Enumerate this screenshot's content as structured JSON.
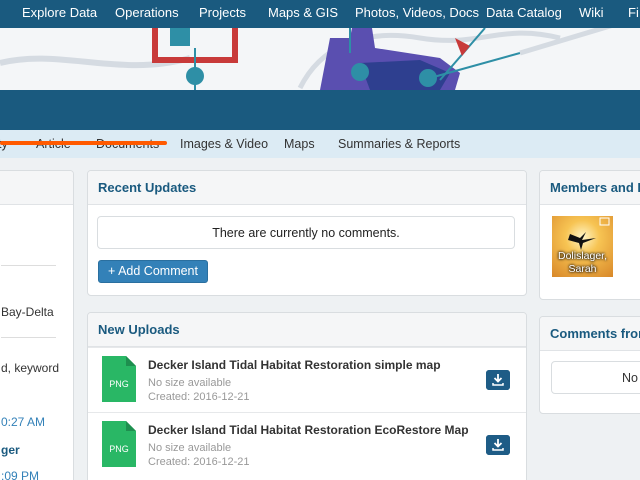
{
  "topnav": [
    "Explore Data",
    "Operations",
    "Projects",
    "Maps & GIS",
    "Photos, Videos, Docs",
    "Data Catalog",
    "Wiki",
    "Fi"
  ],
  "subnav": [
    "ty",
    "Article",
    "Documents",
    "Images & Video",
    "Maps",
    "Summaries & Reports"
  ],
  "left_panel": {
    "lines": [
      "Bay-Delta",
      "d, keyword",
      "0:27 AM",
      "ger",
      ":09 PM"
    ]
  },
  "recent_updates": {
    "title": "Recent Updates",
    "empty_text": "There are currently no comments.",
    "add_button": "+ Add Comment"
  },
  "new_uploads": {
    "title": "New Uploads",
    "items": [
      {
        "type": "PNG",
        "title": "Decker Island Tidal Habitat Restoration simple map",
        "size": "No size available",
        "created": "Created: 2016-12-21"
      },
      {
        "type": "PNG",
        "title": "Decker Island Tidal Habitat Restoration EcoRestore Map",
        "size": "No size available",
        "created": "Created: 2016-12-21"
      }
    ]
  },
  "members": {
    "title": "Members and Fo",
    "member_name": "Dolislager, Sarah"
  },
  "comments_from": {
    "title": "Comments from",
    "text": "No c"
  },
  "colors": {
    "nav": "#1a5a7f",
    "accent": "#ff5a00",
    "button": "#3381b8",
    "png": "#29b765"
  }
}
